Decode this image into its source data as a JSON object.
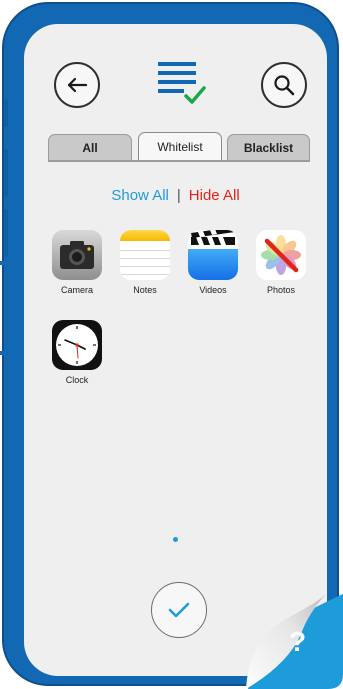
{
  "header": {
    "back_icon": "arrow-left-icon",
    "logo_icon": "list-check-icon",
    "search_icon": "search-icon"
  },
  "tabs": [
    {
      "label": "All",
      "active": false
    },
    {
      "label": "Whitelist",
      "active": true
    },
    {
      "label": "Blacklist",
      "active": false
    }
  ],
  "actions": {
    "show_all": "Show All",
    "separator": "|",
    "hide_all": "Hide All"
  },
  "apps": [
    {
      "label": "Camera",
      "icon": "camera-icon"
    },
    {
      "label": "Notes",
      "icon": "notes-icon"
    },
    {
      "label": "Videos",
      "icon": "videos-icon"
    },
    {
      "label": "Photos",
      "icon": "photos-icon",
      "blocked": true
    },
    {
      "label": "Clock",
      "icon": "clock-icon"
    }
  ],
  "pager": {
    "pages": 1,
    "current": 1
  },
  "confirm_icon": "checkmark-icon",
  "help": {
    "label": "?"
  },
  "colors": {
    "frame": "#1268b3",
    "accent_blue": "#1e9bd9",
    "accent_red": "#e2231a",
    "check_green": "#18a84a"
  }
}
